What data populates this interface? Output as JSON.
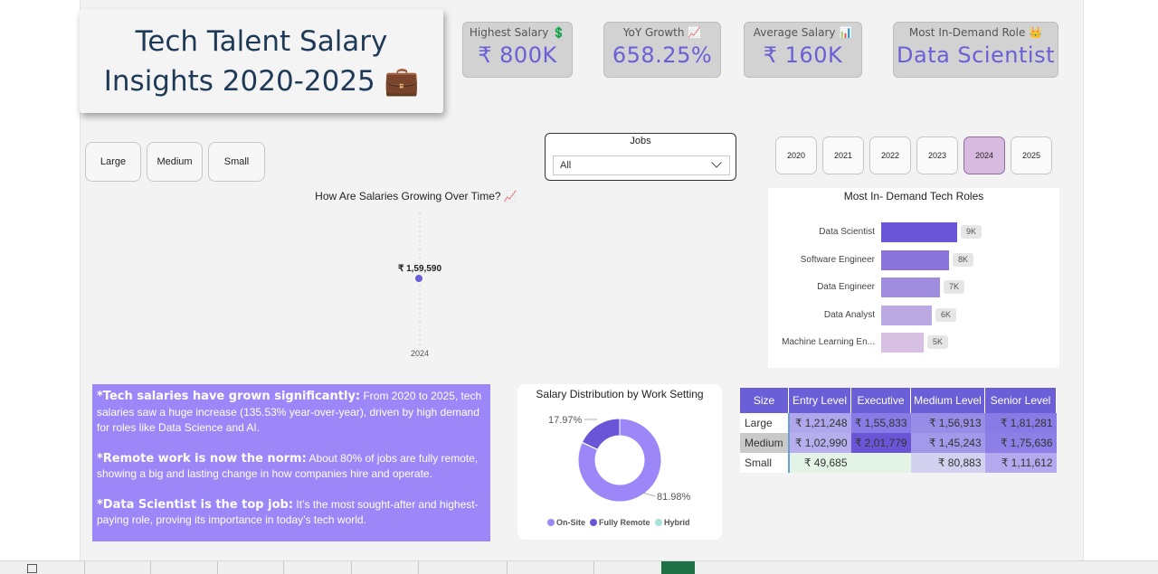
{
  "title": {
    "line1": "Tech Talent Salary",
    "line2": "Insights 2020-2025",
    "icon": "💼"
  },
  "kpis": [
    {
      "label": "Highest Salary 💲",
      "value": "₹ 800K"
    },
    {
      "label": "YoY Growth 📈",
      "value": "658.25%"
    },
    {
      "label": "Average Salary 📊",
      "value": "₹ 160K"
    },
    {
      "label": "Most In-Demand Role 👑",
      "value": "Data Scientist"
    }
  ],
  "size_filters": [
    "Large",
    "Medium",
    "Small"
  ],
  "jobs_filter": {
    "label": "Jobs",
    "value": "All"
  },
  "years": [
    "2020",
    "2021",
    "2022",
    "2023",
    "2024",
    "2025"
  ],
  "selected_year": "2024",
  "colors": {
    "accent": "#6a5fd6",
    "insights_bg": "#9b87f7",
    "title_text": "#1e3a56"
  },
  "growth_chart": {
    "title": "How Are Salaries Growing Over Time? 📈",
    "point_label": "₹ 1,59,590",
    "x_label": "2024"
  },
  "roles_chart": {
    "title": "Most In- Demand Tech Roles",
    "items": [
      {
        "label": "Data Scientist",
        "value_label": "9K",
        "color": "#6a55d6"
      },
      {
        "label": "Software Engineer",
        "value_label": "8K",
        "color": "#8a74dc"
      },
      {
        "label": "Data Engineer",
        "value_label": "7K",
        "color": "#a18de0"
      },
      {
        "label": "Data Analyst",
        "value_label": "6K",
        "color": "#bba9e3"
      },
      {
        "label": "Machine Learning En...",
        "value_label": "5K",
        "color": "#d8c0e2"
      }
    ]
  },
  "insights": [
    {
      "heading": "*Tech salaries have grown significantly:",
      "text": " From 2020 to 2025, tech salaries saw a huge increase (135.53% year-over-year), driven by high demand for roles like Data Science and AI."
    },
    {
      "heading": "*Remote work is now the norm:",
      "text": " About 80% of jobs are fully remote, showing a big and lasting change in how companies hire and operate."
    },
    {
      "heading": "*Data Scientist is the top job:",
      "text": " It’s the most sought-after and highest-paying role, proving its importance in today’s tech world."
    }
  ],
  "donut": {
    "title": "Salary Distribution by Work Setting",
    "label_small": "17.97%",
    "label_large": "81.98%",
    "legend": [
      "On-Site",
      "Fully Remote",
      "Hybrid"
    ]
  },
  "salary_table": {
    "headers": [
      "Size",
      "Entry Level",
      "Executive",
      "Medium Level",
      "Senior Level"
    ],
    "rows": [
      [
        "Large",
        "₹ 1,21,248",
        "₹ 1,55,833",
        "₹ 1,56,913",
        "₹ 1,81,281"
      ],
      [
        "Medium",
        "₹ 1,02,990",
        "₹ 2,01,779",
        "₹ 1,45,243",
        "₹ 1,75,636"
      ],
      [
        "Small",
        "₹ 49,685",
        "",
        "₹ 80,883",
        "₹ 1,11,612"
      ]
    ]
  },
  "chart_data": [
    {
      "type": "line",
      "title": "How Are Salaries Growing Over Time? 📈",
      "x": [
        "2024"
      ],
      "series": [
        {
          "values": [
            159590
          ]
        }
      ],
      "data_labels": [
        "₹ 1,59,590"
      ]
    },
    {
      "type": "bar",
      "title": "Most In- Demand Tech Roles",
      "orientation": "horizontal",
      "categories": [
        "Data Scientist",
        "Software Engineer",
        "Data Engineer",
        "Data Analyst",
        "Machine Learning En..."
      ],
      "values": [
        9000,
        8000,
        7000,
        6000,
        5000
      ],
      "data_labels": [
        "9K",
        "8K",
        "7K",
        "6K",
        "5K"
      ]
    },
    {
      "type": "pie",
      "title": "Salary Distribution by Work Setting",
      "categories": [
        "On-Site",
        "Fully Remote",
        "Hybrid"
      ],
      "values": [
        81.98,
        17.97,
        0.05
      ],
      "colors": [
        "#9b87f7",
        "#6a55d6",
        "#a9e2d6"
      ],
      "legend": "bottom"
    }
  ]
}
